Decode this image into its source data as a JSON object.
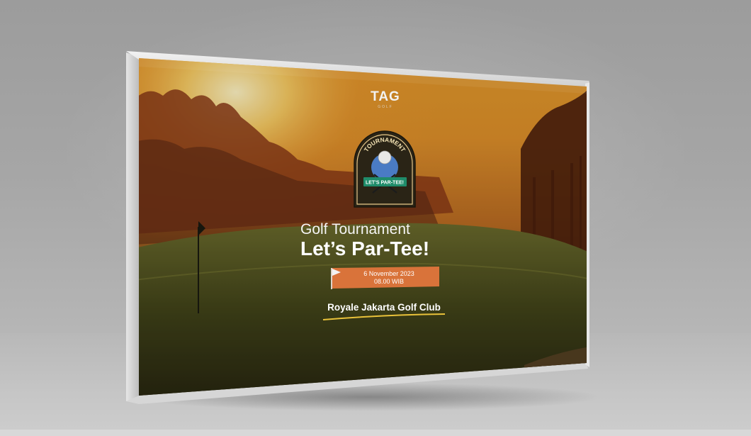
{
  "brand": {
    "logo_text": "TAG",
    "logo_sub": "GOLF"
  },
  "badge": {
    "arc_text": "TOURNAMENT",
    "ribbon_text": "LET'S PAR-TEE!",
    "icon": "golf-ball-crossed-clubs-icon"
  },
  "headline": {
    "line1": "Golf Tournament",
    "line2": "Let’s Par-Tee!"
  },
  "event": {
    "date": "6 November 2023",
    "time": "08.00 WIB",
    "flag_icon": "golf-flag-icon"
  },
  "venue": {
    "name": "Royale Jakarta Golf Club"
  },
  "colors": {
    "accent_orange": "#d9733a",
    "badge_blue": "#4a7bc4",
    "ribbon_green": "#1f8c6a",
    "underline_yellow": "#e9c23a",
    "sky_glow": "#f6c24a"
  }
}
